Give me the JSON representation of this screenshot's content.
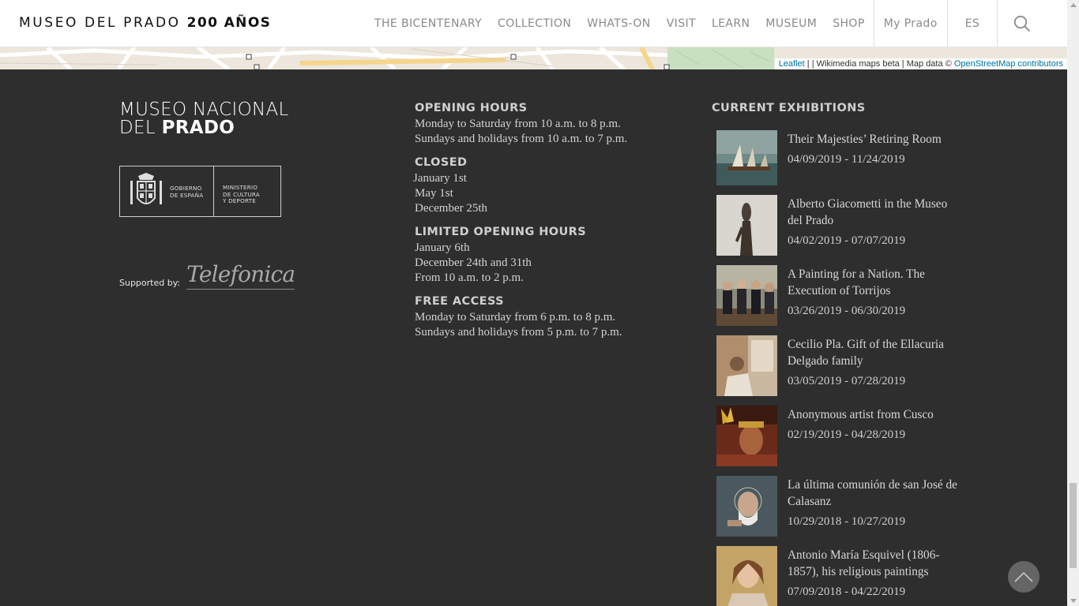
{
  "header": {
    "logo_text": "MUSEO DEL PRADO",
    "logo_bold": "200 AÑOS",
    "nav": {
      "bicentenary": "THE BICENTENARY",
      "collection": "COLLECTION",
      "whats_on": "WHATS-ON",
      "visit": "VISIT",
      "learn": "LEARN",
      "museum": "MUSEUM",
      "shop": "SHOP",
      "my_prado": "My Prado",
      "lang": "ES"
    },
    "search_icon": "search-icon"
  },
  "map": {
    "attribution_leaflet": "Leaflet",
    "attribution_rest": " | | Wikimedia maps beta | Map data © ",
    "attribution_osm": "OpenStreetMap contributors"
  },
  "footer": {
    "brand_line1": "MUSEO NACIONAL",
    "brand_line2_a": "DEL ",
    "brand_line2_b": "PRADO",
    "gov_left_1": "GOBIERNO",
    "gov_left_2": "DE ESPAÑA",
    "gov_right_1": "MINISTERIO",
    "gov_right_2": "DE CULTURA",
    "gov_right_3": "Y DEPORTE",
    "supported_by": "Supported by:",
    "sponsor": "Telefonica",
    "hours": [
      {
        "heading": "OPENING HOURS",
        "lines": [
          "Monday to Saturday from 10 a.m. to 8 p.m.",
          "Sundays and holidays from 10 a.m. to 7 p.m."
        ]
      },
      {
        "heading": "CLOSED",
        "lines": [
          "January 1st",
          "May 1st",
          "December 25th"
        ]
      },
      {
        "heading": "LIMITED OPENING HOURS",
        "lines": [
          "January 6th",
          "December 24th and 31th",
          "From 10 a.m. to 2 p.m."
        ]
      },
      {
        "heading": "FREE ACCESS",
        "lines": [
          "Monday to Saturday from 6 p.m. to 8 p.m.",
          "Sundays and holidays from 5 p.m. to 7 p.m."
        ]
      }
    ],
    "exhibitions_heading": "CURRENT EXHIBITIONS",
    "exhibitions": [
      {
        "title": "Their Majesties’ Retiring Room",
        "dates": "04/09/2019 - 11/24/2019"
      },
      {
        "title": "Alberto Giacometti in the Museo del Prado",
        "dates": "04/02/2019 - 07/07/2019"
      },
      {
        "title": "A Painting for a Nation. The Execution of Torrijos",
        "dates": "03/26/2019 - 06/30/2019"
      },
      {
        "title": "Cecilio Pla. Gift of the Ellacuria Delgado family",
        "dates": "03/05/2019 - 07/28/2019"
      },
      {
        "title": "Anonymous artist from Cusco",
        "dates": "02/19/2019 - 04/28/2019"
      },
      {
        "title": "La última comunión de san José de Calasanz",
        "dates": "10/29/2018 - 10/27/2019"
      },
      {
        "title": "Antonio María Esquivel (1806-1857), his religious paintings",
        "dates": "07/09/2018 - 04/22/2019"
      }
    ]
  }
}
